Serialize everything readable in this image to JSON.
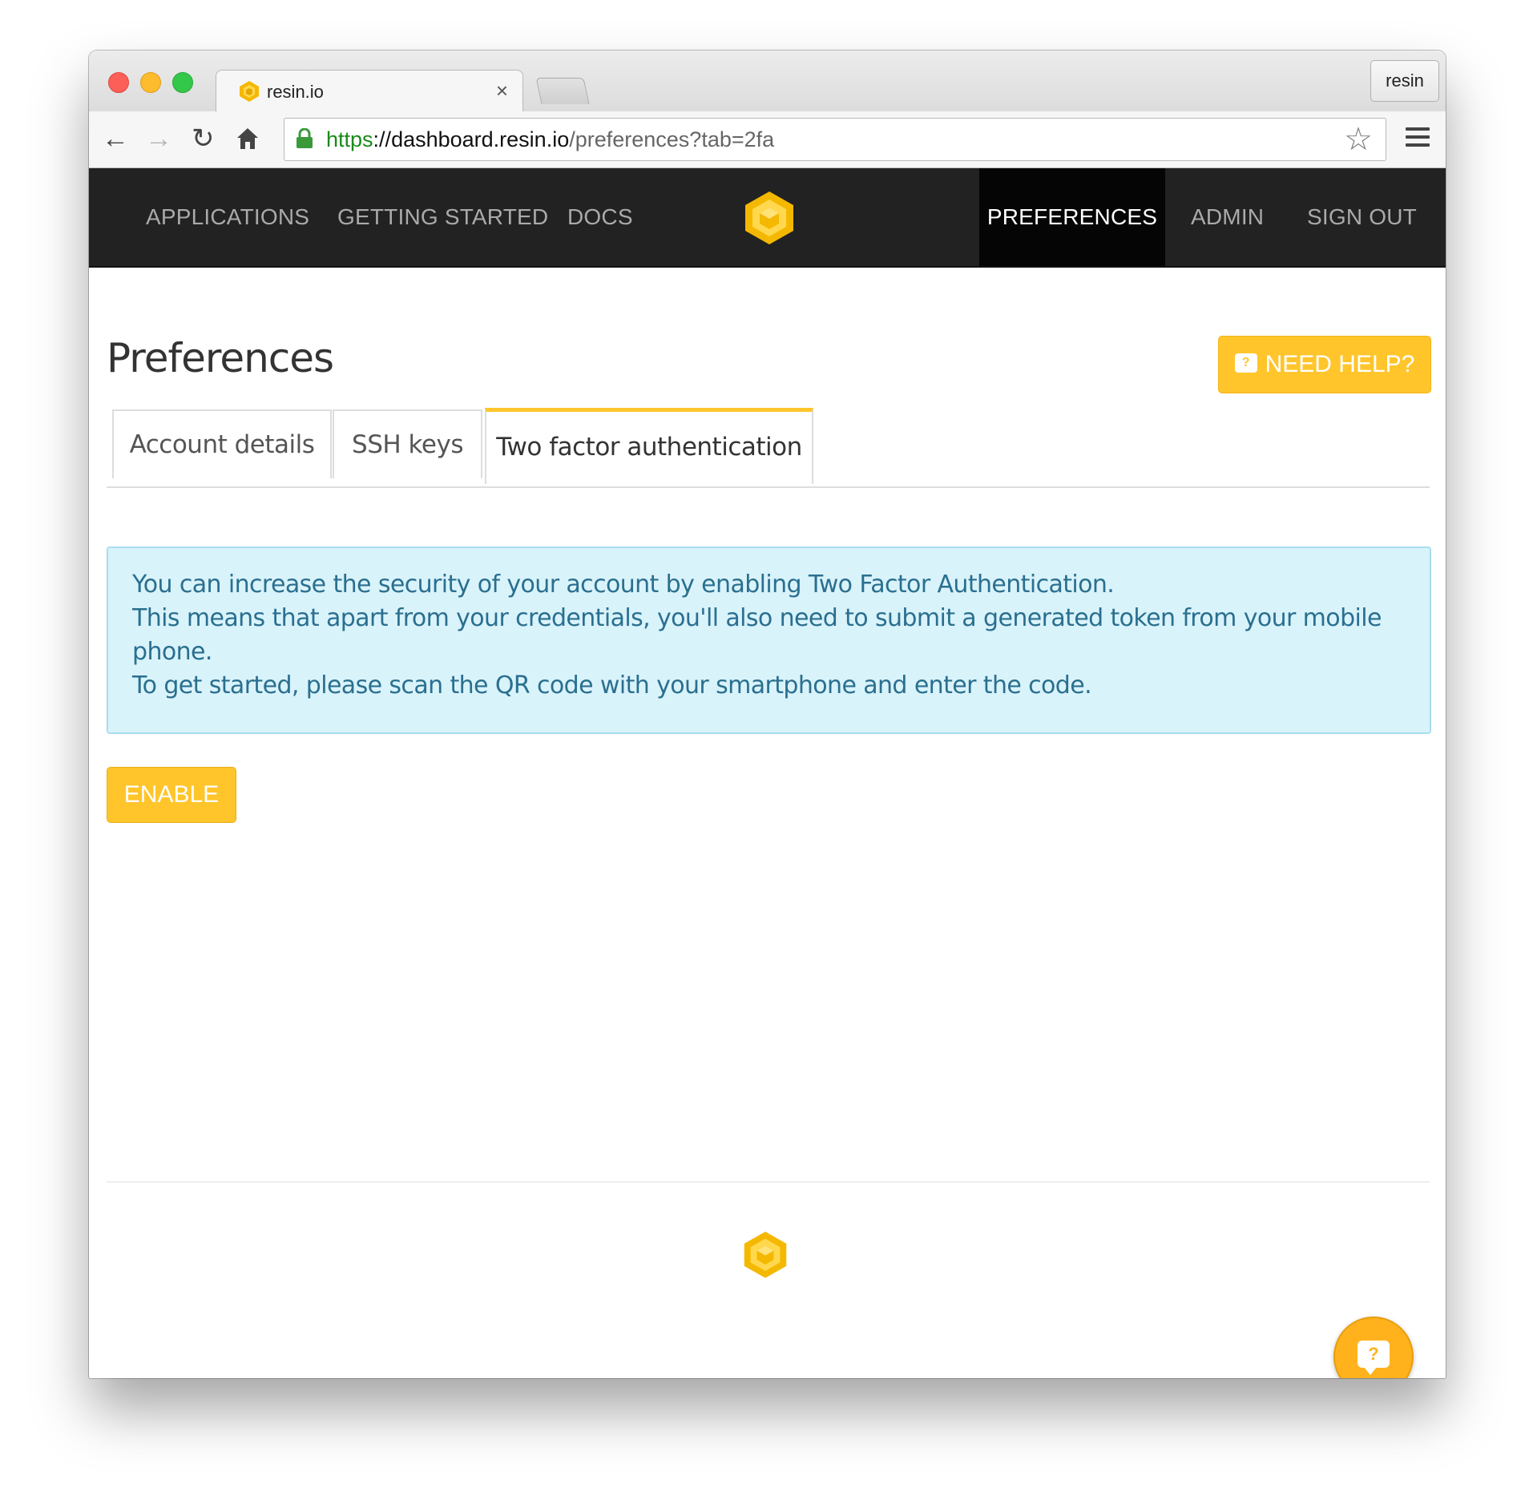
{
  "browser": {
    "tab_title": "resin.io",
    "tab_close": "×",
    "profile_label": "resin",
    "url_scheme": "https",
    "url_sep": "://",
    "url_host": "dashboard.resin.io",
    "url_path": "/preferences?tab=2fa",
    "icons": [
      "back-arrow-icon",
      "forward-arrow-icon",
      "reload-icon",
      "home-icon",
      "lock-icon",
      "star-icon",
      "menu-icon"
    ]
  },
  "nav": {
    "applications": "APPLICATIONS",
    "getting_started": "GETTING STARTED",
    "docs": "DOCS",
    "preferences": "PREFERENCES",
    "admin": "ADMIN",
    "sign_out": "SIGN OUT",
    "active": "PREFERENCES"
  },
  "page": {
    "title": "Preferences",
    "help_label": "NEED HELP?",
    "help_icon_glyph": "?",
    "tabs": [
      "Account details",
      "SSH keys",
      "Two factor authentication"
    ],
    "active_tab": "Two factor authentication",
    "alert_lines": [
      "You can increase the security of your account by enabling Two Factor Authentication.",
      "This means that apart from your credentials, you'll also need to submit a generated token from your mobile",
      "phone.",
      "To get started, please scan the QR code with your smartphone and enter the code."
    ],
    "enable_label": "ENABLE",
    "float_help_glyph": "?"
  },
  "colors": {
    "accent": "#ffc52b",
    "nav_bg": "#222222",
    "nav_active_bg": "#050505",
    "alert_bg": "#d9f3fb",
    "alert_text": "#2a6f8f"
  }
}
